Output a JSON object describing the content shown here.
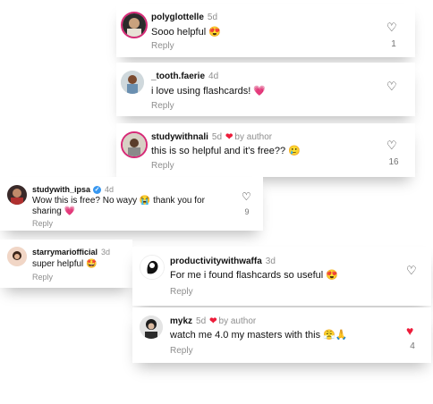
{
  "comments": [
    {
      "username": "polyglottelle",
      "time": "5d",
      "text": "Sooo helpful 😍",
      "reply": "Reply",
      "likes": "1",
      "heart": "♡",
      "author_like": "",
      "by_author": ""
    },
    {
      "username": "_tooth.faerie",
      "time": "4d",
      "text": "i love using flashcards! 💗",
      "reply": "Reply",
      "likes": "",
      "heart": "♡",
      "author_like": "",
      "by_author": ""
    },
    {
      "username": "studywithnali",
      "time": "5d",
      "text": "this is so helpful and it's free?? 🥲",
      "reply": "Reply",
      "likes": "16",
      "heart": "♡",
      "author_like": "❤",
      "by_author": "by author"
    },
    {
      "username": "studywith_ipsa",
      "time": "4d",
      "verified": "✓",
      "text_line1": "Wow this is free? No wayy 😭 thank you for",
      "text_line2": "sharing 💗",
      "reply": "Reply",
      "likes": "9",
      "heart": "♡"
    },
    {
      "username": "starrymariofficial",
      "time": "3d",
      "text": "super helpful 🤩",
      "reply": "Reply",
      "likes": "",
      "heart": ""
    },
    {
      "username": "productivitywithwaffa",
      "time": "3d",
      "text": "For me i found flashcards so useful 😍",
      "reply": "Reply",
      "likes": "",
      "heart": "♡"
    },
    {
      "username": "mykz",
      "time": "5d",
      "text": "watch me 4.0 my masters with this 😤🙏",
      "reply": "Reply",
      "likes": "4",
      "heart": "♥",
      "author_like": "❤",
      "by_author": "by author"
    }
  ],
  "colors": {
    "accent_heart": "#ed1c3a",
    "muted": "#8e8e8e",
    "verified": "#3797f0"
  }
}
